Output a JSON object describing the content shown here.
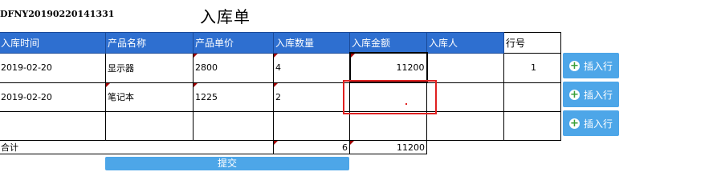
{
  "doc_no": "DFNY20190220141331",
  "title": "入库单",
  "columns": [
    "入库时间",
    "产品名称",
    "产品单价",
    "入库数量",
    "入库金额",
    "入库人",
    "行号"
  ],
  "rows": [
    {
      "date": "2019-02-20",
      "product": "显示器",
      "price": "2800",
      "qty": "4",
      "amount": "11200",
      "person": "",
      "line": "1"
    },
    {
      "date": "2019-02-20",
      "product": "笔记本",
      "price": "1225",
      "qty": "2",
      "amount": "",
      "person": "",
      "line": ""
    },
    {
      "date": "",
      "product": "",
      "price": "",
      "qty": "",
      "amount": "",
      "person": "",
      "line": ""
    }
  ],
  "total": {
    "label": "合计",
    "qty": "6",
    "amount": "11200"
  },
  "insert_label": "插入行",
  "submit_label": "提交"
}
